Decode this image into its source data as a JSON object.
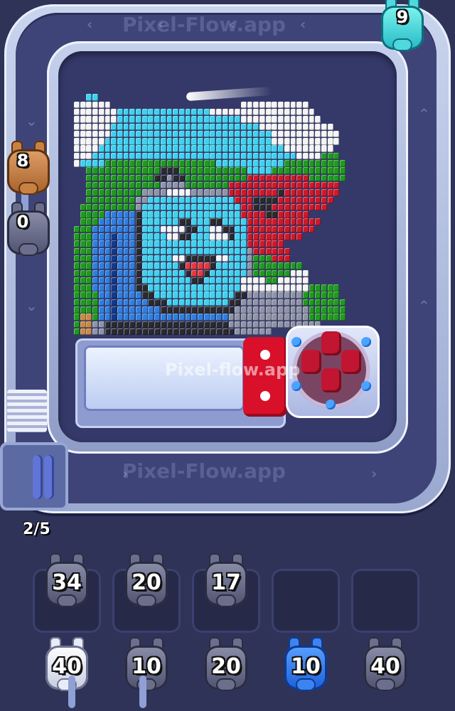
{
  "game": {
    "watermark_belt": "Pixel-Flow.app",
    "watermark_board": "Pixel-flow.app",
    "progress": "2/5"
  },
  "belt_pigs": {
    "top_right": {
      "count": "9",
      "color": "teal"
    },
    "left_upper": {
      "count": "8",
      "color": "brown"
    },
    "left_lower": {
      "count": "0",
      "color": "grey"
    }
  },
  "slots_row1": [
    {
      "count": "34",
      "color": "grey"
    },
    {
      "count": "20",
      "color": "grey"
    },
    {
      "count": "17",
      "color": "grey"
    },
    {
      "empty": true
    },
    {
      "empty": true
    }
  ],
  "slots_row2": [
    {
      "count": "40",
      "color": "white"
    },
    {
      "count": "10",
      "color": "grey"
    },
    {
      "count": "20",
      "color": "grey"
    },
    {
      "count": "10",
      "color": "blue"
    },
    {
      "count": "40",
      "color": "grey"
    }
  ],
  "palette": {
    "W": "#f4f4f6",
    "C": "#3fd2f0",
    "G": "#1f9a1f",
    "D": "#2b2b2e",
    "R": "#d0182b",
    "B": "#2f7ee0",
    "N": "#143a8a",
    "S": "#8f94a8",
    "O": "#c98a45",
    "P": "#e8383a"
  },
  "pixel_rows": [
    ".............................................",
    "..CC.........................................",
    "WWWWWW.....................WWWWWWWWWWW.......",
    "WWWWWWWCCCCCCCCCCCCCCCWWWWWWWWWWWWWWWWW......",
    "WWWWWWWCCCCCCCCCCCCCCCCCCCCWWWWWWWWWWWWW.....",
    "WWWWWWCCCCCCCCCCCCCCCCCCCCCCCCWWWWWWWWWWWW...",
    "WWWWWWCCCCCCCCCCCCCCCCCCCCCCCCCCWWWWWWWWWWW..",
    "WWWWWCCCCCCCCCCCCCCCCCCCCCCCCCCCWWWWWWWWWWW..",
    "WWWWCCCCCCCCCCCCCCCCCCCCCCCCCCCCCCWWWWWWWW...",
    "WWWCCCCCCCCCCCCCCCCCCCCCCCCCCCCCCCCCWWWWGGG..",
    "WCCCCGGGGGGGGGGGGGGGGGGCCCCCCCCCCCGGGGGGGGGG.",
    "..GGGGGGGGGGGGDDDGGGGGGGGGGGCCCCGGGGGGGGGGGG.",
    "..GGGGGGGGGGGDDSDDGGGGGGGGGGRRRRRRRRRRGGGGGG.",
    "..GGGGGGGGGGGGSSSSGGGGGGGRRRRRRRRRRRRRRRRRR..",
    "..GGGGGGGGGSSSSWWWWSSSSSSRRRRRRRRDRRRRRRRRR..",
    "..GGGGGGGGSSCCCCCCCCCCCCCCRRRDDDDRRRRRRRRR...",
    ".GGGGGGGGGSCCCCCCCCCCCCCCCCRRDDDRRRRRRRRR....",
    ".GGGGBBBBBDCCCCCCCCCCCCCCCCRRRRDDRRRRR.......",
    ".GGGBBBBBBDCCCCCCDDCCCDDCCCCRRRRRRRRRRRR.....",
    "GGGBBBBBBBDCCCWWWWDDCCWWDDCCRRRRRRRRRRR......",
    "GGGBBBNBBBDCCCCWWDDCCCWWWDCCRRRRRRRRR........",
    "GGGBBBNBBBDCCCCCCCCCCCCCCCCCRRRRRR...........",
    "GGGBBBNBBBDCCCCCCCCCCCCCCCCCSRRRRRR..........",
    "GGGBBBNBBBDCCCCCWWDDDDDWWCCCSGGGRRR..........",
    "GGGBBBNBBBDCCCCCCDPPPPDCCCCCSGGGGGGGG........",
    "GGGBBBNBBBDCCCCCCCDPPDCCCCCCSGGGGGGWWW.......",
    "GGGBBBNBBBDCCCCCCCCDDCCCCCCWWWWGGWWWWW.......",
    "GGGBBBNBBBDDCCCCCCCCCCCCCCCWWWWWWWWWWWGGGGG..",
    "GGGGBBNBBBBDDCCCCCCCCCCCCCDDSSSSSSSSSGGGGGG..",
    "GGGGBBNBBBBBDDDCCCCCCCCCCDDSSSSSSSSSSGGGGGGG.",
    "GGGGBBNBBBBBBBDDDDDDDDDDDDSSSSSSSSSSSSGGGGGG.",
    "GOOGBBNBBBBBBBBBBBBBBBBBBSSSSSSSSSSSSSGGGGGG.",
    "GOOSSDDDDDDDDDDDDDDDDDDDDSSSSSSSSSSSSSSS.....",
    "GOOSSDDDDDDDDDDDDDDDDDDDDDSSSSSS............."
  ]
}
